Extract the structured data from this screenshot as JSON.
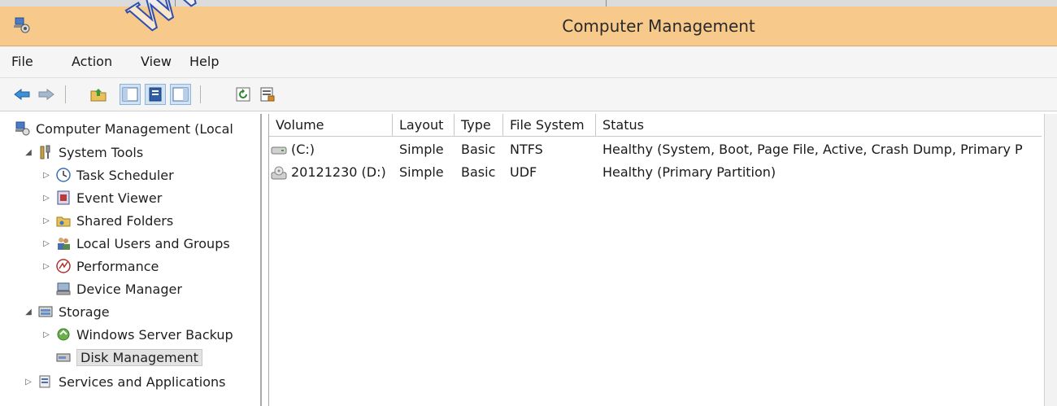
{
  "window": {
    "title": "Computer Management"
  },
  "watermark": "WWW",
  "menu": [
    "File",
    "Action",
    "View",
    "Help"
  ],
  "toolbar": [
    "back",
    "forward",
    "up",
    "show-hide-console-tree",
    "properties",
    "help",
    "refresh",
    "export-list"
  ],
  "tree": {
    "root": "Computer Management (Local",
    "system_tools": "System Tools",
    "task_scheduler": "Task Scheduler",
    "event_viewer": "Event Viewer",
    "shared_folders": "Shared Folders",
    "local_users": "Local Users and Groups",
    "performance": "Performance",
    "device_manager": "Device Manager",
    "storage": "Storage",
    "wsb": "Windows Server Backup",
    "disk_management": "Disk Management",
    "services": "Services and Applications"
  },
  "table": {
    "headers": [
      "Volume",
      "Layout",
      "Type",
      "File System",
      "Status"
    ],
    "rows": [
      {
        "volume": "(C:)",
        "layout": "Simple",
        "type": "Basic",
        "fs": "NTFS",
        "status": "Healthy (System, Boot, Page File, Active, Crash Dump, Primary P"
      },
      {
        "volume": "20121230 (D:)",
        "layout": "Simple",
        "type": "Basic",
        "fs": "UDF",
        "status": "Healthy (Primary Partition)"
      }
    ]
  },
  "colors": {
    "titlebar": "#f7c98b",
    "accent_blue": "#2f4fb0"
  }
}
